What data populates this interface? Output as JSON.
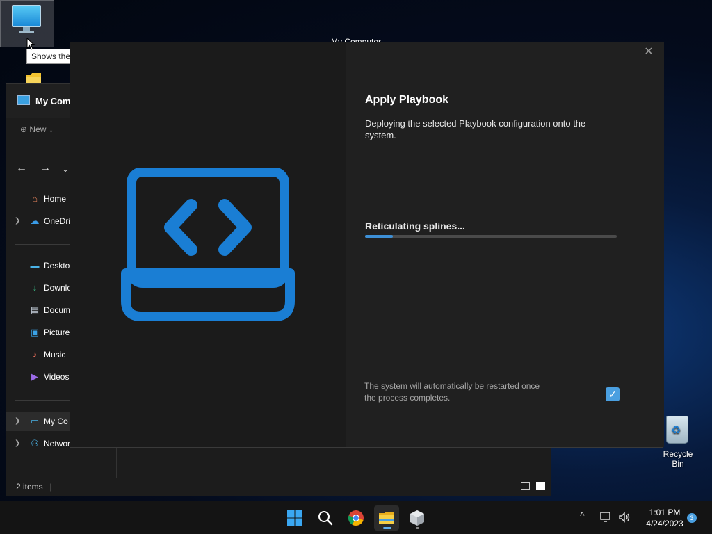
{
  "desktop": {
    "my_computer_label": "My Computer",
    "tooltip": "Shows the disk drives and hardware connected to this computer.",
    "recycle_bin_label": "Recycle Bin"
  },
  "explorer": {
    "title": "My Comp",
    "new_label": "New",
    "sidebar": [
      {
        "label": "Home",
        "icon": "home-icon",
        "expandable": false
      },
      {
        "label": "OneDri",
        "icon": "cloud-icon",
        "expandable": true
      },
      {
        "label": "Deskto",
        "icon": "desktop-icon",
        "expandable": false
      },
      {
        "label": "Downlo",
        "icon": "download-icon",
        "expandable": false
      },
      {
        "label": "Docum",
        "icon": "document-icon",
        "expandable": false
      },
      {
        "label": "Picture",
        "icon": "picture-icon",
        "expandable": false
      },
      {
        "label": "Music",
        "icon": "music-icon",
        "expandable": false
      },
      {
        "label": "Videos",
        "icon": "video-icon",
        "expandable": false
      },
      {
        "label": "My Co",
        "icon": "computer-icon",
        "expandable": true
      },
      {
        "label": "Networ",
        "icon": "network-icon",
        "expandable": true
      }
    ],
    "status": "2 items"
  },
  "dialog": {
    "title": "Apply Playbook",
    "description": "Deploying the selected Playbook configuration onto the system.",
    "progress_label": "Reticulating splines...",
    "progress_fraction": 0.11,
    "note": "The system will automatically be restarted once the process completes.",
    "restart_checked": true,
    "accent_color": "#3d8fd6",
    "close_glyph": "✕",
    "check_glyph": "✓"
  },
  "taskbar": {
    "time": "1:01 PM",
    "date": "4/24/2023",
    "notification_count": "3",
    "tray_chevron": "^"
  }
}
